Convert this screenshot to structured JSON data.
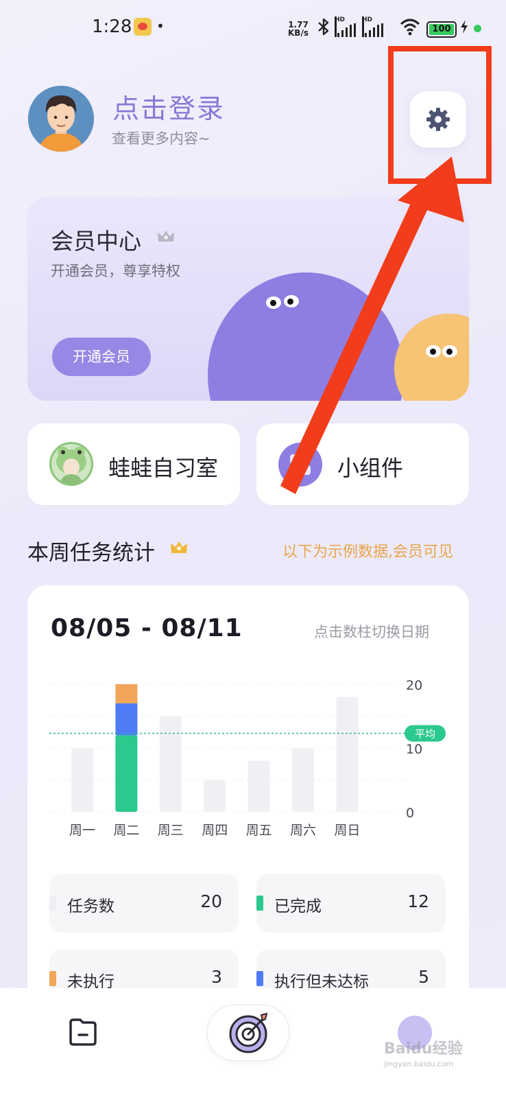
{
  "status_bar": {
    "time": "1:28",
    "dot": "•",
    "net_speed_value": "1.77",
    "net_speed_unit": "KB/s",
    "hd1": "HD",
    "hd2": "HD",
    "battery": "100",
    "icons": [
      "weibo-icon",
      "bluetooth-icon",
      "signal-icon",
      "wifi-icon",
      "battery-icon",
      "charging-icon"
    ]
  },
  "profile": {
    "login_title": "点击登录",
    "login_subtitle": "查看更多内容~"
  },
  "member_card": {
    "title": "会员中心",
    "subtitle": "开通会员，尊享特权",
    "button_label": "开通会员"
  },
  "tiles": [
    {
      "label": "蛙蛙自习室",
      "icon": "frog-avatar-icon"
    },
    {
      "label": "小组件",
      "icon": "widget-icon"
    }
  ],
  "weekly_stats": {
    "title": "本周任务统计",
    "note": "以下为示例数据,会员可见",
    "date_range": "08/05 - 08/11",
    "date_hint": "点击数柱切换日期"
  },
  "chart_data": {
    "type": "bar",
    "categories": [
      "周一",
      "周二",
      "周三",
      "周四",
      "周五",
      "周六",
      "周日"
    ],
    "series": [
      {
        "name": "任务数",
        "values": [
          10,
          20,
          15,
          5,
          8,
          10,
          18
        ]
      },
      {
        "name": "已完成",
        "values": [
          0,
          12,
          0,
          0,
          0,
          0,
          0
        ]
      },
      {
        "name": "执行但未达标",
        "values": [
          0,
          5,
          0,
          0,
          0,
          0,
          0
        ]
      },
      {
        "name": "未执行",
        "values": [
          0,
          3,
          0,
          0,
          0,
          0,
          0
        ]
      }
    ],
    "yticks": [
      0,
      10,
      20
    ],
    "ylim": [
      0,
      20
    ],
    "average": 12.3,
    "average_label": "平均",
    "grid": true,
    "colors": {
      "total": "#f0f0f4",
      "completed": "#2bc98d",
      "below_target": "#4f7cf6",
      "not_executed": "#f0a55a",
      "average_line": "#2bb59a"
    }
  },
  "legend": [
    {
      "label": "任务数",
      "value": "20",
      "color": "#efeff3"
    },
    {
      "label": "已完成",
      "value": "12",
      "color": "#2bc98d"
    },
    {
      "label": "未执行",
      "value": "3",
      "color": "#f0a55a"
    },
    {
      "label": "执行但未达标",
      "value": "5",
      "color": "#4f7cf6"
    }
  ],
  "bottom_nav": {
    "items": [
      "home-icon",
      "target-icon",
      "profile-icon"
    ],
    "watermark": "Baidu经验",
    "watermark_sub": "jingyan.baidu.com"
  },
  "annotation": {
    "color": "#f13d1b"
  }
}
